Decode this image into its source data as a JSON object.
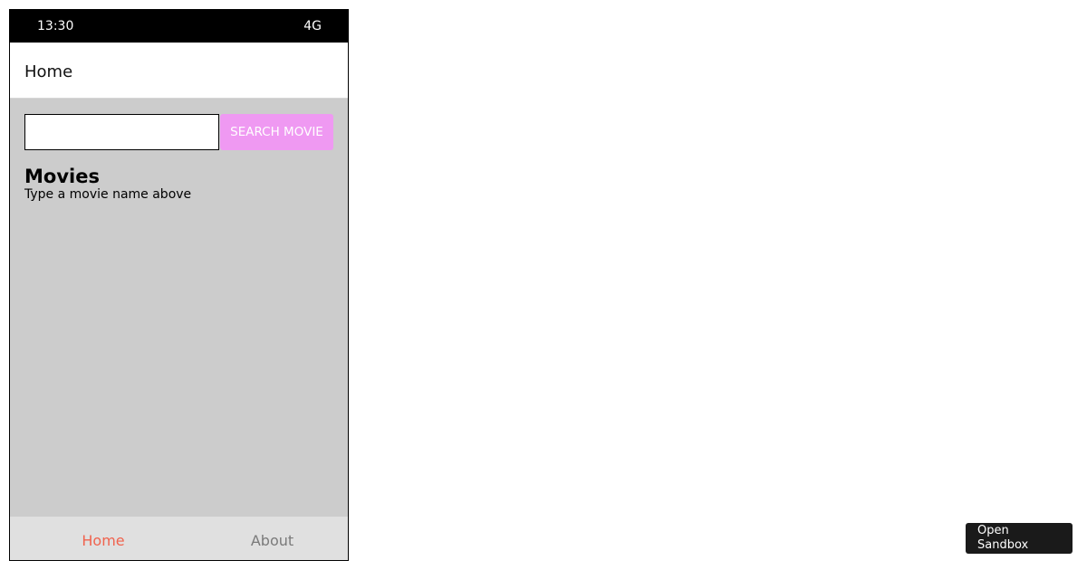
{
  "status_bar": {
    "time": "13:30",
    "network": "4G"
  },
  "header": {
    "title": "Home"
  },
  "search": {
    "input_value": "",
    "placeholder": "",
    "button_label": "SEARCH MOVIE"
  },
  "movies": {
    "heading": "Movies",
    "hint": "Type a movie name above"
  },
  "bottom_nav": {
    "tabs": [
      {
        "label": "Home",
        "active": true
      },
      {
        "label": "About",
        "active": false
      }
    ]
  },
  "sandbox_button": {
    "line1": "Open",
    "line2": "Sandbox"
  },
  "colors": {
    "accent_active_tab": "#f0634e",
    "inactive_tab": "#7a7a7a",
    "search_button_bg": "#ef99f2",
    "content_bg": "#cccccc",
    "status_bar_bg": "#000000",
    "bottom_nav_bg": "#e0e0e0",
    "sandbox_button_bg": "#1a1a1a"
  }
}
